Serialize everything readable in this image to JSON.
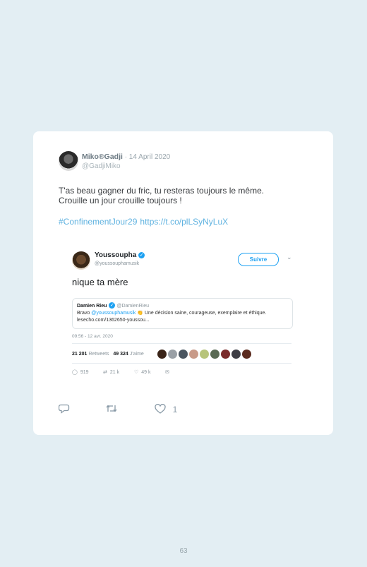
{
  "tweet": {
    "author_name": "Miko®Gadji",
    "date": "· 14 April 2020",
    "handle": "@GadjiMiko",
    "text_line1": "T'as beau gagner du fric, tu resteras toujours le même.",
    "text_line2": "Crouille un jour crouille toujours !",
    "hashtag": "#ConfinementJour29",
    "link": "https://t.co/plLSyNyLuX",
    "like_count": "1"
  },
  "embedded": {
    "name": "Youssoupha",
    "handle": "@youssouphamusik",
    "follow_label": "Suivre",
    "text": "nique ta mère",
    "quote": {
      "author": "Damien Rieu",
      "handle": "@DamienRieu",
      "body_prefix": "Bravo ",
      "body_mention": "@youssouphamusik",
      "body_rest": " 👏 Une décision saine, courageuse, exemplaire et éthique.",
      "body_line2": "lesecho.com/1362650-youssou..."
    },
    "time": "09:56 - 12 avr. 2020",
    "retweets": "21 201",
    "retweets_label": "Retweets",
    "likes": "49 324",
    "likes_label": "J'aime",
    "replies_count": "919",
    "rt_count": "21 k",
    "like_count": "49 k",
    "liker_colors": [
      "#3a2418",
      "#9aa0a6",
      "#4a5560",
      "#c89a88",
      "#b7c47a",
      "#5a6a54",
      "#7a2a2a",
      "#3e3e46",
      "#5b2a1e"
    ]
  },
  "page_number": "63",
  "colors": {
    "background": "#e3eef3",
    "link": "#5fb2e0",
    "twitter_blue": "#1da1f2"
  },
  "icons": [
    "reply-icon",
    "retweet-icon",
    "heart-icon",
    "verified-icon",
    "chevron-down-icon",
    "mail-icon"
  ]
}
